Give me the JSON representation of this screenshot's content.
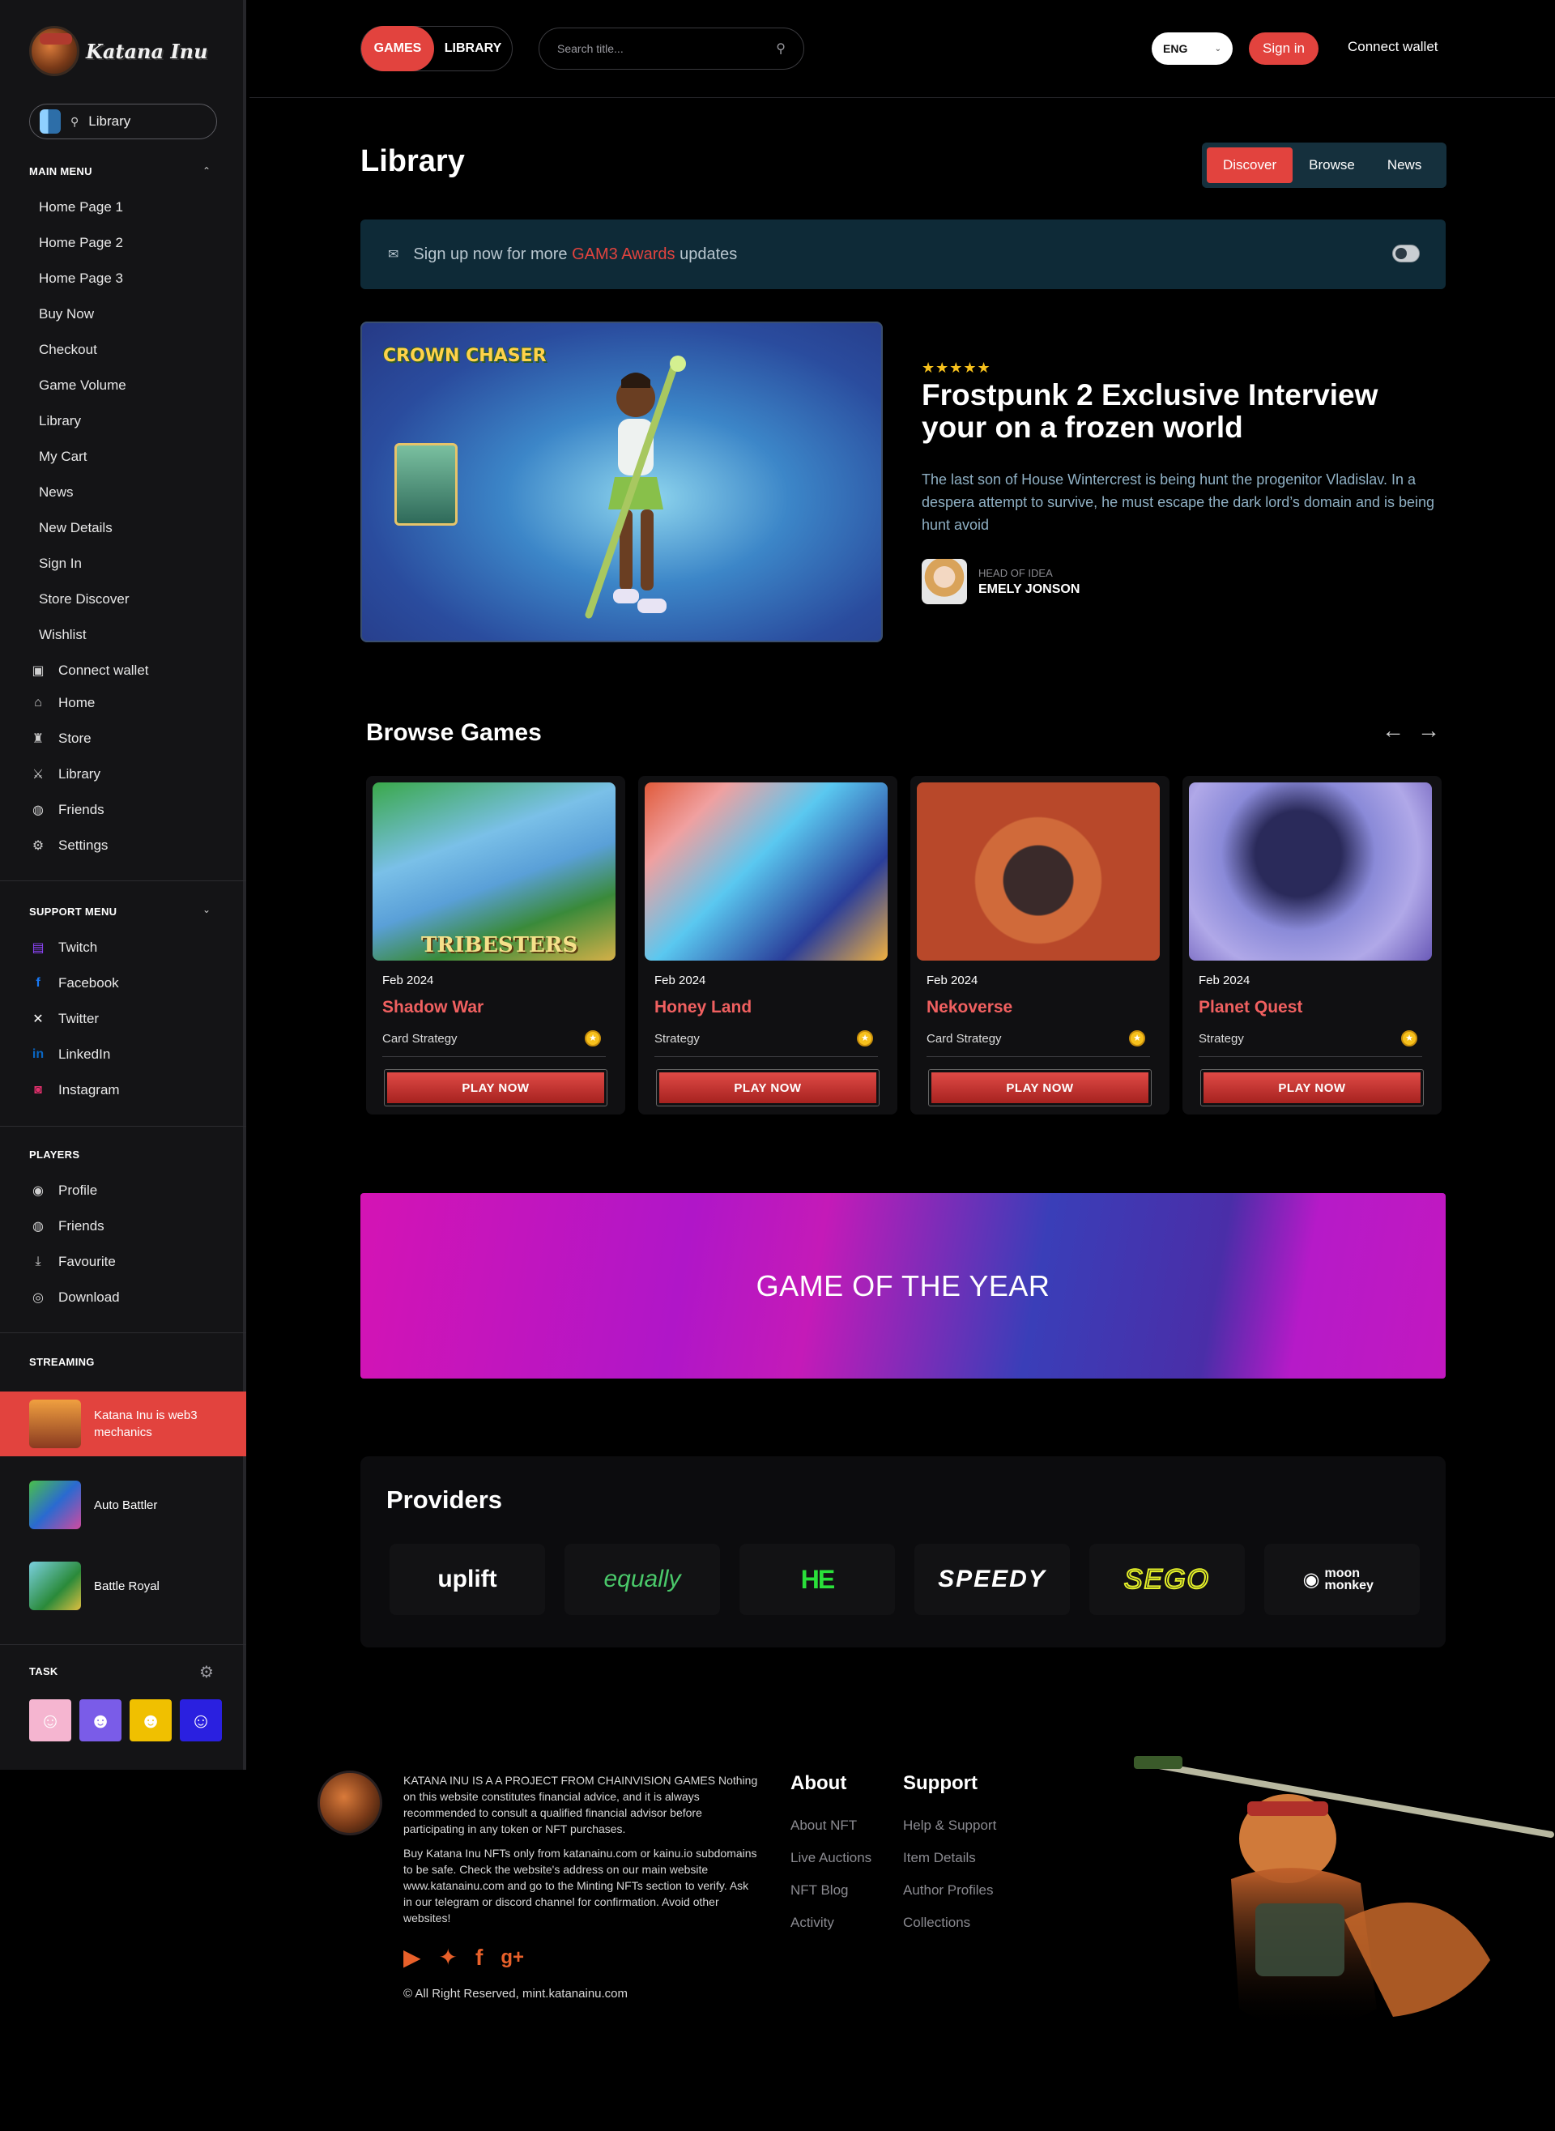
{
  "brand": {
    "logo_text": "Katana Inu"
  },
  "sidebar": {
    "search_value": "Library",
    "main_menu_title": "MAIN MENU",
    "main_menu": [
      "Home Page 1",
      "Home Page 2",
      "Home Page 3",
      "Buy Now",
      "Checkout",
      "Game Volume",
      "Library",
      "My Cart",
      "News",
      "New Details",
      "Sign In",
      "Store Discover",
      "Wishlist"
    ],
    "nav": [
      {
        "label": "Connect wallet",
        "icon": "wallet-icon"
      },
      {
        "label": "Home",
        "icon": "home-icon"
      },
      {
        "label": "Store",
        "icon": "store-icon"
      },
      {
        "label": "Library",
        "icon": "swords-icon"
      },
      {
        "label": "Friends",
        "icon": "friends-icon"
      },
      {
        "label": "Settings",
        "icon": "gear-icon"
      }
    ],
    "support_menu_title": "SUPPORT MENU",
    "support": [
      {
        "label": "Twitch",
        "icon": "twitch-icon",
        "color": "#9146ff"
      },
      {
        "label": "Facebook",
        "icon": "facebook-icon",
        "color": "#1877f2"
      },
      {
        "label": "Twitter",
        "icon": "x-icon",
        "color": "#ffffff"
      },
      {
        "label": "LinkedIn",
        "icon": "linkedin-icon",
        "color": "#0a66c2"
      },
      {
        "label": "Instagram",
        "icon": "instagram-icon",
        "color": "#e1306c"
      }
    ],
    "players_title": "PLAYERS",
    "players": [
      {
        "label": "Profile",
        "icon": "profile-icon"
      },
      {
        "label": "Friends",
        "icon": "friends-icon"
      },
      {
        "label": "Favourite",
        "icon": "download-tray-icon"
      },
      {
        "label": "Download",
        "icon": "gamepad-icon"
      }
    ],
    "streaming_title": "STREAMING",
    "streaming": [
      {
        "label": "Katana Inu is web3 mechanics",
        "active": true
      },
      {
        "label": "Auto Battler",
        "active": false
      },
      {
        "label": "Battle Royal",
        "active": false
      }
    ],
    "task_title": "TASK"
  },
  "header": {
    "tab_games": "GAMES",
    "tab_library": "LIBRARY",
    "search_placeholder": "Search title...",
    "language": "ENG",
    "signin": "Sign in",
    "connect": "Connect wallet"
  },
  "page": {
    "title": "Library",
    "tabs": [
      "Discover",
      "Browse",
      "News"
    ],
    "active_tab": "Discover"
  },
  "banner": {
    "prefix": "Sign up now for more ",
    "highlight": "GAM3 Awards",
    "suffix": " updates"
  },
  "feature": {
    "image_brand": "CROWN CHASER",
    "rating_stars": 5,
    "stars_text": "★★★★★",
    "title": "Frostpunk 2 Exclusive Interview your on a frozen world",
    "description": "The last son of House Wintercrest is being hunt the progenitor Vladislav. In a despera attempt to survive, he must escape the dark lord’s domain and is being hunt avoid",
    "author_role": "HEAD OF IDEA",
    "author_name": "EMELY JONSON"
  },
  "browse": {
    "title": "Browse Games",
    "games": [
      {
        "date": "Feb 2024",
        "name": "Shadow War",
        "genre": "Card Strategy",
        "button": "PLAY NOW",
        "thumb_text": "TRIBESTERS"
      },
      {
        "date": "Feb 2024",
        "name": "Honey Land",
        "genre": "Strategy",
        "button": "PLAY NOW",
        "thumb_text": ""
      },
      {
        "date": "Feb 2024",
        "name": "Nekoverse",
        "genre": "Card Strategy",
        "button": "PLAY NOW",
        "thumb_text": ""
      },
      {
        "date": "Feb 2024",
        "name": "Planet Quest",
        "genre": "Strategy",
        "button": "PLAY NOW",
        "thumb_text": ""
      }
    ]
  },
  "goty": {
    "text": "GAME OF THE YEAR"
  },
  "providers": {
    "title": "Providers",
    "logos": [
      "uplift",
      "equally",
      "HE",
      "SPEEDY",
      "SEGO",
      "moon monkey"
    ]
  },
  "footer": {
    "about_p1": "KATANA INU IS A A PROJECT FROM CHAINVISION GAMES Nothing on this website constitutes financial advice, and it is always recommended to consult a qualified financial advisor before participating in any token or NFT purchases.",
    "about_p2": "Buy Katana Inu NFTs only from katanainu.com or kainu.io subdomains to be safe. Check the website's address on our main website www.katanainu.com and go to the Minting NFTs section to verify. Ask in our telegram or discord channel for confirmation. Avoid other websites!",
    "about_title": "About",
    "about_links": [
      "About NFT",
      "Live Auctions",
      "NFT Blog",
      "Activity"
    ],
    "support_title": "Support",
    "support_links": [
      "Help & Support",
      "Item Details",
      "Author Profiles",
      "Collections"
    ],
    "social": [
      "youtube-icon",
      "twitter-icon",
      "facebook-icon",
      "google-plus-icon"
    ],
    "copyright": "© All Right Reserved, mint.katanainu.com"
  },
  "colors": {
    "accent": "#e2433e",
    "banner_bg": "#0e2a37",
    "game_title": "#f06060"
  }
}
